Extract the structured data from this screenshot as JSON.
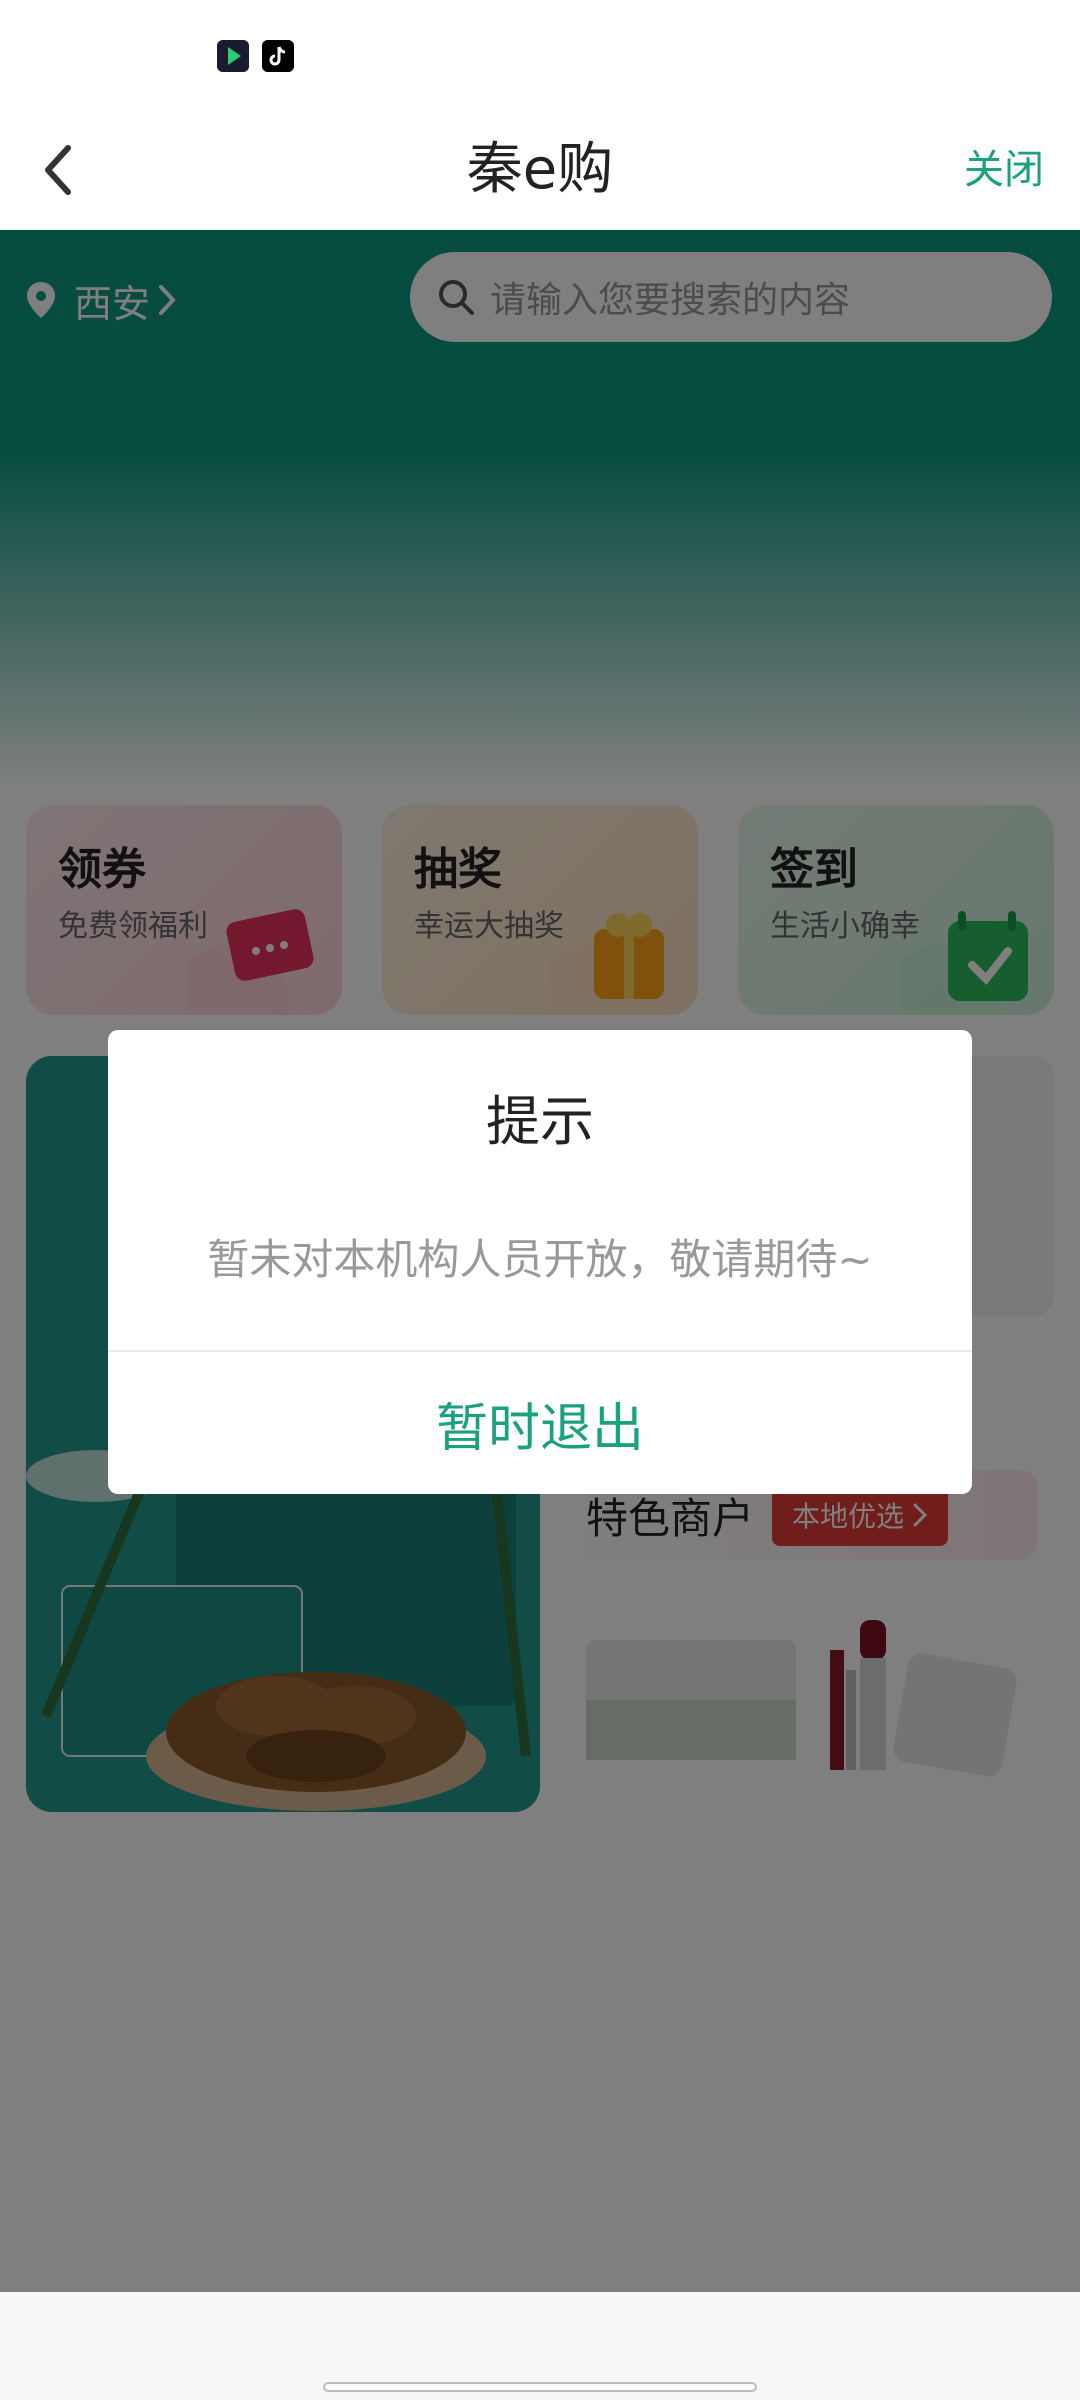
{
  "header": {
    "title": "秦e购",
    "close_label": "关闭"
  },
  "location": {
    "city": "西安"
  },
  "search": {
    "placeholder": "请输入您要搜索的内容"
  },
  "quick_cards": [
    {
      "title": "领券",
      "subtitle": "免费领福利"
    },
    {
      "title": "抽奖",
      "subtitle": "幸运大抽奖"
    },
    {
      "title": "签到",
      "subtitle": "生活小确幸"
    }
  ],
  "merchant": {
    "title": "特色商户",
    "badge": "本地优选"
  },
  "dialog": {
    "title": "提示",
    "message": "暂未对本机构人员开放，敬请期待~",
    "button_label": "暂时退出"
  },
  "colors": {
    "brand_green": "#0c9a80",
    "accent_text": "#1aa17f",
    "badge_red": "#e23a36",
    "overlay": "rgba(0,0,0,0.5)"
  }
}
